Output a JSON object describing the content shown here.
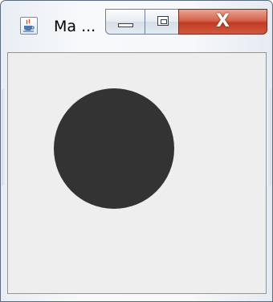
{
  "window": {
    "title": "Ma ...",
    "icon": "java-cup-icon",
    "buttons": {
      "minimize": "minimize-icon",
      "maximize": "maximize-icon",
      "close_label": "X"
    }
  },
  "canvas": {
    "background": "#eeeeee",
    "shape": "circle",
    "fill": "#333333"
  }
}
